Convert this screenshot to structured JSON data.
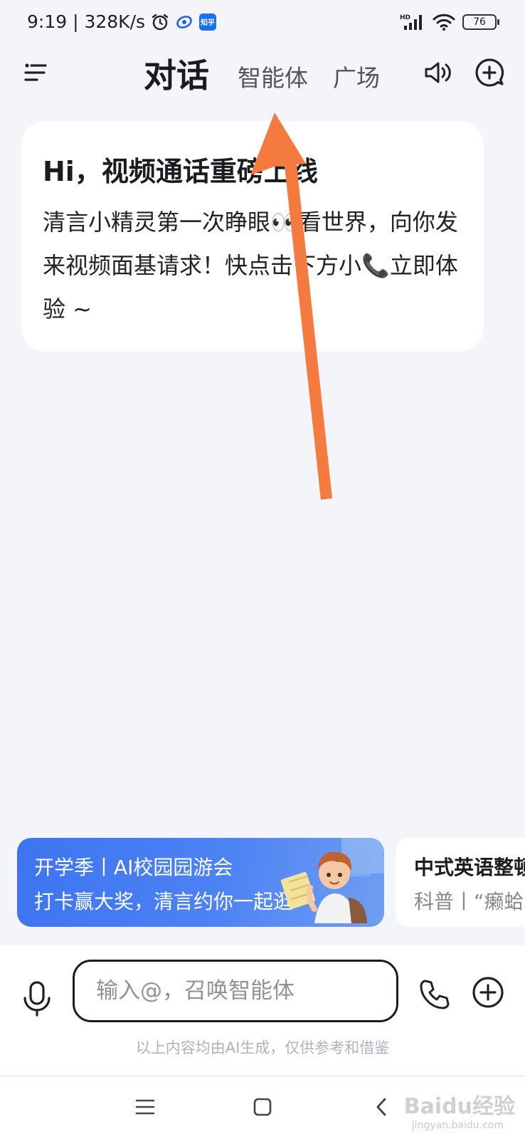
{
  "status_bar": {
    "time_speed": "9:19 | 328K/s",
    "zhihu_badge": "知乎",
    "hd_label": "HD",
    "battery": "76"
  },
  "header": {
    "tabs": [
      {
        "label": "对话",
        "active": true
      },
      {
        "label": "智能体",
        "active": false
      },
      {
        "label": "广场",
        "active": false
      }
    ],
    "icons": [
      "menu-icon",
      "speaker-icon",
      "new-chat-icon"
    ]
  },
  "welcome_card": {
    "title": "Hi，视频通话重磅上线",
    "body": "清言小精灵第一次睁眼👀看世界，向你发来视频面基请求！快点击下方小📞立即体验 ~"
  },
  "promos": [
    {
      "title": "开学季丨AI校园园游会",
      "subtitle": "打卡赢大奖，清言约你一起逛~"
    },
    {
      "title": "中式英语整顿",
      "subtitle": "科普丨“癞蛤蟆"
    }
  ],
  "input": {
    "placeholder": "输入@，召唤智能体",
    "disclaimer": "以上内容均由AI生成，仅供参考和借鉴"
  },
  "nav": {
    "icons": [
      "recents-icon",
      "home-icon",
      "back-icon"
    ]
  },
  "watermark": {
    "text": "Baidu经验",
    "url": "jingyan.baidu.com"
  },
  "colors": {
    "accent": "#4d82f4",
    "annotation": "#f47a3f",
    "background": "#f4f5f9"
  }
}
